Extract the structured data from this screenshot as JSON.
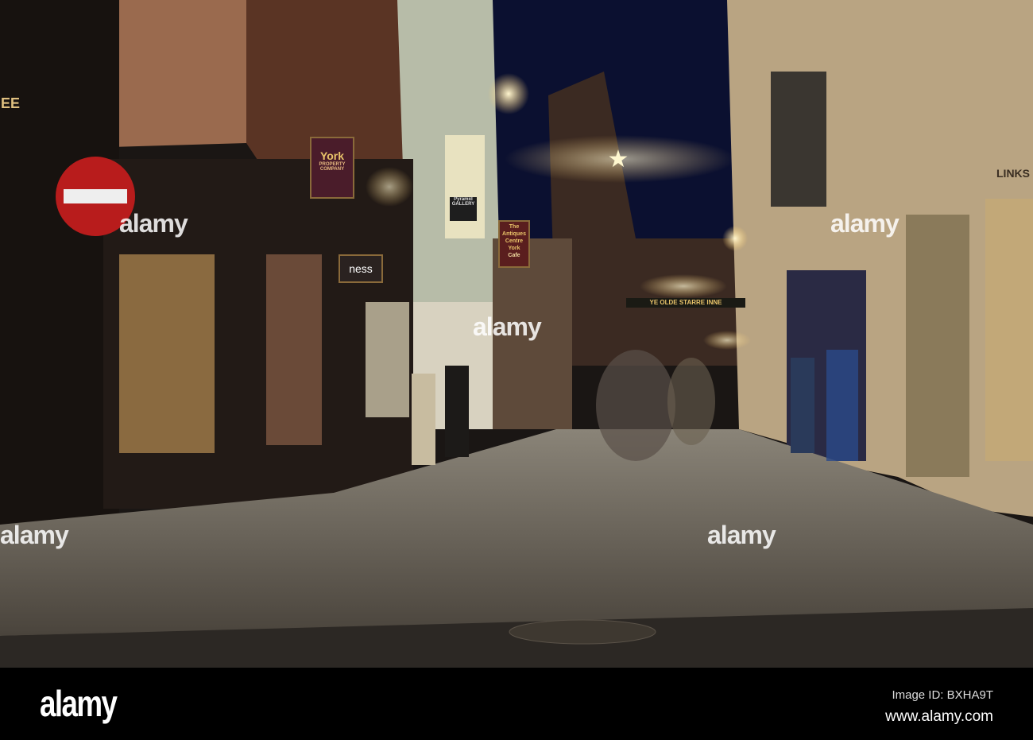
{
  "photo": {
    "signs": {
      "york_property": {
        "title": "York",
        "subtitle": "PROPERTY COMPANY"
      },
      "ness": "ness",
      "antiques_centre": "The Antiques Centre York",
      "cafe": "Cafe",
      "pyramid_gallery": "Pyramid GALLERY",
      "starre_inne": "YE OLDE STARRE INNE",
      "links": "LINKS",
      "left_shop": "EE"
    },
    "watermark": "alamy"
  },
  "footer": {
    "logo": "alamy",
    "image_id": "Image ID: BXHA9T",
    "url": "www.alamy.com"
  }
}
